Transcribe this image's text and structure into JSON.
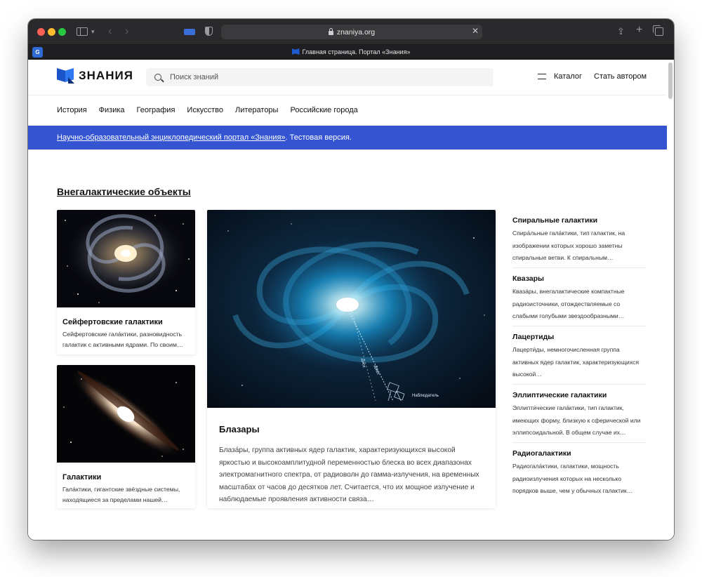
{
  "browser": {
    "url": "znaniya.org",
    "tab_title": "Главная страница. Портал «Знания»",
    "tab_ext_badge": "G"
  },
  "header": {
    "logo_text": "ЗНАНИЯ",
    "search_placeholder": "Поиск знаний",
    "catalog_label": "Каталог",
    "author_label": "Стать автором"
  },
  "nav": {
    "categories": [
      "История",
      "Физика",
      "География",
      "Искусство",
      "Литераторы",
      "Российские города"
    ]
  },
  "banner": {
    "link_text": "Научно-образовательный энциклопедический портал «Знания»",
    "suffix": ". Тестовая версия."
  },
  "section": {
    "title": "Внегалактические объекты"
  },
  "cards": {
    "seyfert": {
      "title": "Сейфертовские галактики",
      "text": "Сейфертовские гала́ктики, разновидность галактик с активными ядрами. По своим…"
    },
    "galaxies": {
      "title": "Галактики",
      "text": "Гала́ктики, гигантские звёздные системы, находящиеся за пределами нашей…"
    },
    "blazars": {
      "title": "Блазары",
      "text": "Блаза́ры, группа активных ядер галактик, характеризующихся высокой яркостью и высокоамплитудной переменностью блеска во всех диапазонах электромагнитного спектра, от радиоволн до гамма-излучения, на временных масштабах от часов до десятков лет. Считается, что их мощное излучение и наблюдаемые проявления активности связа…",
      "diagram_labels": {
        "jet": "Джет",
        "disk": "Диск",
        "observer": "Наблюдатель"
      }
    }
  },
  "side_list": [
    {
      "title": "Спиральные галактики",
      "text": "Спира́льные гала́ктики, тип галактик, на изображении которых хорошо заметны спиральные ветви. К спиральным…"
    },
    {
      "title": "Квазары",
      "text": "Кваза́ры, внегалактические компактные радиоисточники, отождествляемые со слабыми голубыми звездообразными…"
    },
    {
      "title": "Лацертиды",
      "text": "Лацерти́ды, немногочисленная группа активных ядер галактик, характеризующихся высокой…"
    },
    {
      "title": "Эллиптические галактики",
      "text": "Эллипти́ческие гала́ктики, тип галактик, имеющих форму, близкую к сферической или эллипсоидальной. В общем случае их…"
    },
    {
      "title": "Радиогалактики",
      "text": "Радиогала́ктики, галактики, мощность радиоизлучения которых на несколько порядков выше, чем у обычных галактик…"
    }
  ],
  "colors": {
    "banner": "#3454d1",
    "logo_blue": "#1b54c9"
  }
}
